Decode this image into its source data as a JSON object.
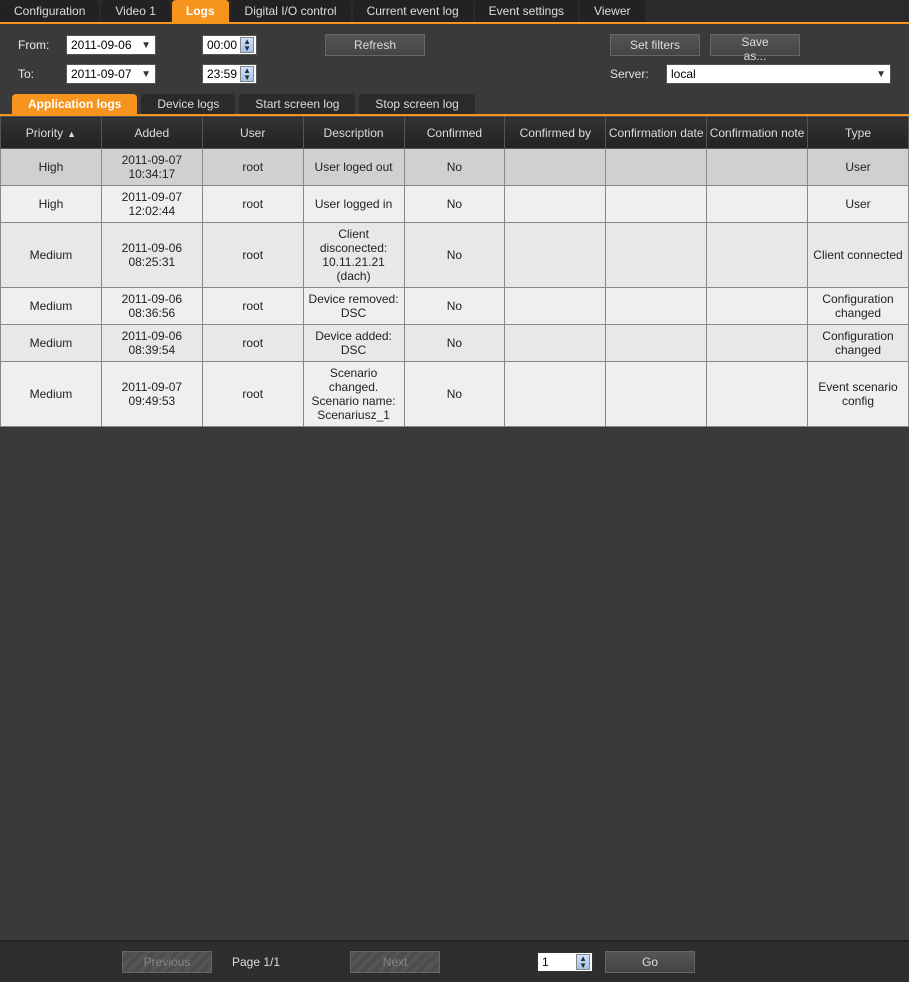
{
  "mainTabs": [
    "Configuration",
    "Video 1",
    "Logs",
    "Digital I/O control",
    "Current event log",
    "Event settings",
    "Viewer"
  ],
  "activeMainTab": "Logs",
  "filters": {
    "fromLabel": "From:",
    "toLabel": "To:",
    "fromDate": "2011-09-06",
    "toDate": "2011-09-07",
    "fromTime": "00:00",
    "toTime": "23:59",
    "refresh": "Refresh",
    "setFilters": "Set filters",
    "saveAs": "Save as...",
    "serverLabel": "Server:",
    "serverValue": "local"
  },
  "subTabs": [
    "Application logs",
    "Device logs",
    "Start screen log",
    "Stop screen log"
  ],
  "activeSubTab": "Application logs",
  "columns": [
    "Priority",
    "Added",
    "User",
    "Description",
    "Confirmed",
    "Confirmed by",
    "Confirmation date",
    "Confirmation note",
    "Type"
  ],
  "rows": [
    {
      "priority": "High",
      "added": "2011-09-07 10:34:17",
      "user": "root",
      "description": "User loged out",
      "confirmed": "No",
      "confirmedBy": "",
      "confDate": "",
      "confNote": "",
      "type": "User",
      "selected": true
    },
    {
      "priority": "High",
      "added": "2011-09-07 12:02:44",
      "user": "root",
      "description": "User logged in",
      "confirmed": "No",
      "confirmedBy": "",
      "confDate": "",
      "confNote": "",
      "type": "User"
    },
    {
      "priority": "Medium",
      "added": "2011-09-06 08:25:31",
      "user": "root",
      "description": "Client disconected: 10.11.21.21 (dach)",
      "confirmed": "No",
      "confirmedBy": "",
      "confDate": "",
      "confNote": "",
      "type": "Client connected"
    },
    {
      "priority": "Medium",
      "added": "2011-09-06 08:36:56",
      "user": "root",
      "description": "Device removed: DSC",
      "confirmed": "No",
      "confirmedBy": "",
      "confDate": "",
      "confNote": "",
      "type": "Configuration changed"
    },
    {
      "priority": "Medium",
      "added": "2011-09-06 08:39:54",
      "user": "root",
      "description": "Device added: DSC",
      "confirmed": "No",
      "confirmedBy": "",
      "confDate": "",
      "confNote": "",
      "type": "Configuration changed"
    },
    {
      "priority": "Medium",
      "added": "2011-09-07 09:49:53",
      "user": "root",
      "description": "Scenario changed. Scenario name: Scenariusz_1",
      "confirmed": "No",
      "confirmedBy": "",
      "confDate": "",
      "confNote": "",
      "type": "Event scenario config"
    }
  ],
  "pager": {
    "previous": "Previous",
    "next": "Next",
    "pageLabel": "Page 1/1",
    "pageValue": "1",
    "go": "Go"
  }
}
